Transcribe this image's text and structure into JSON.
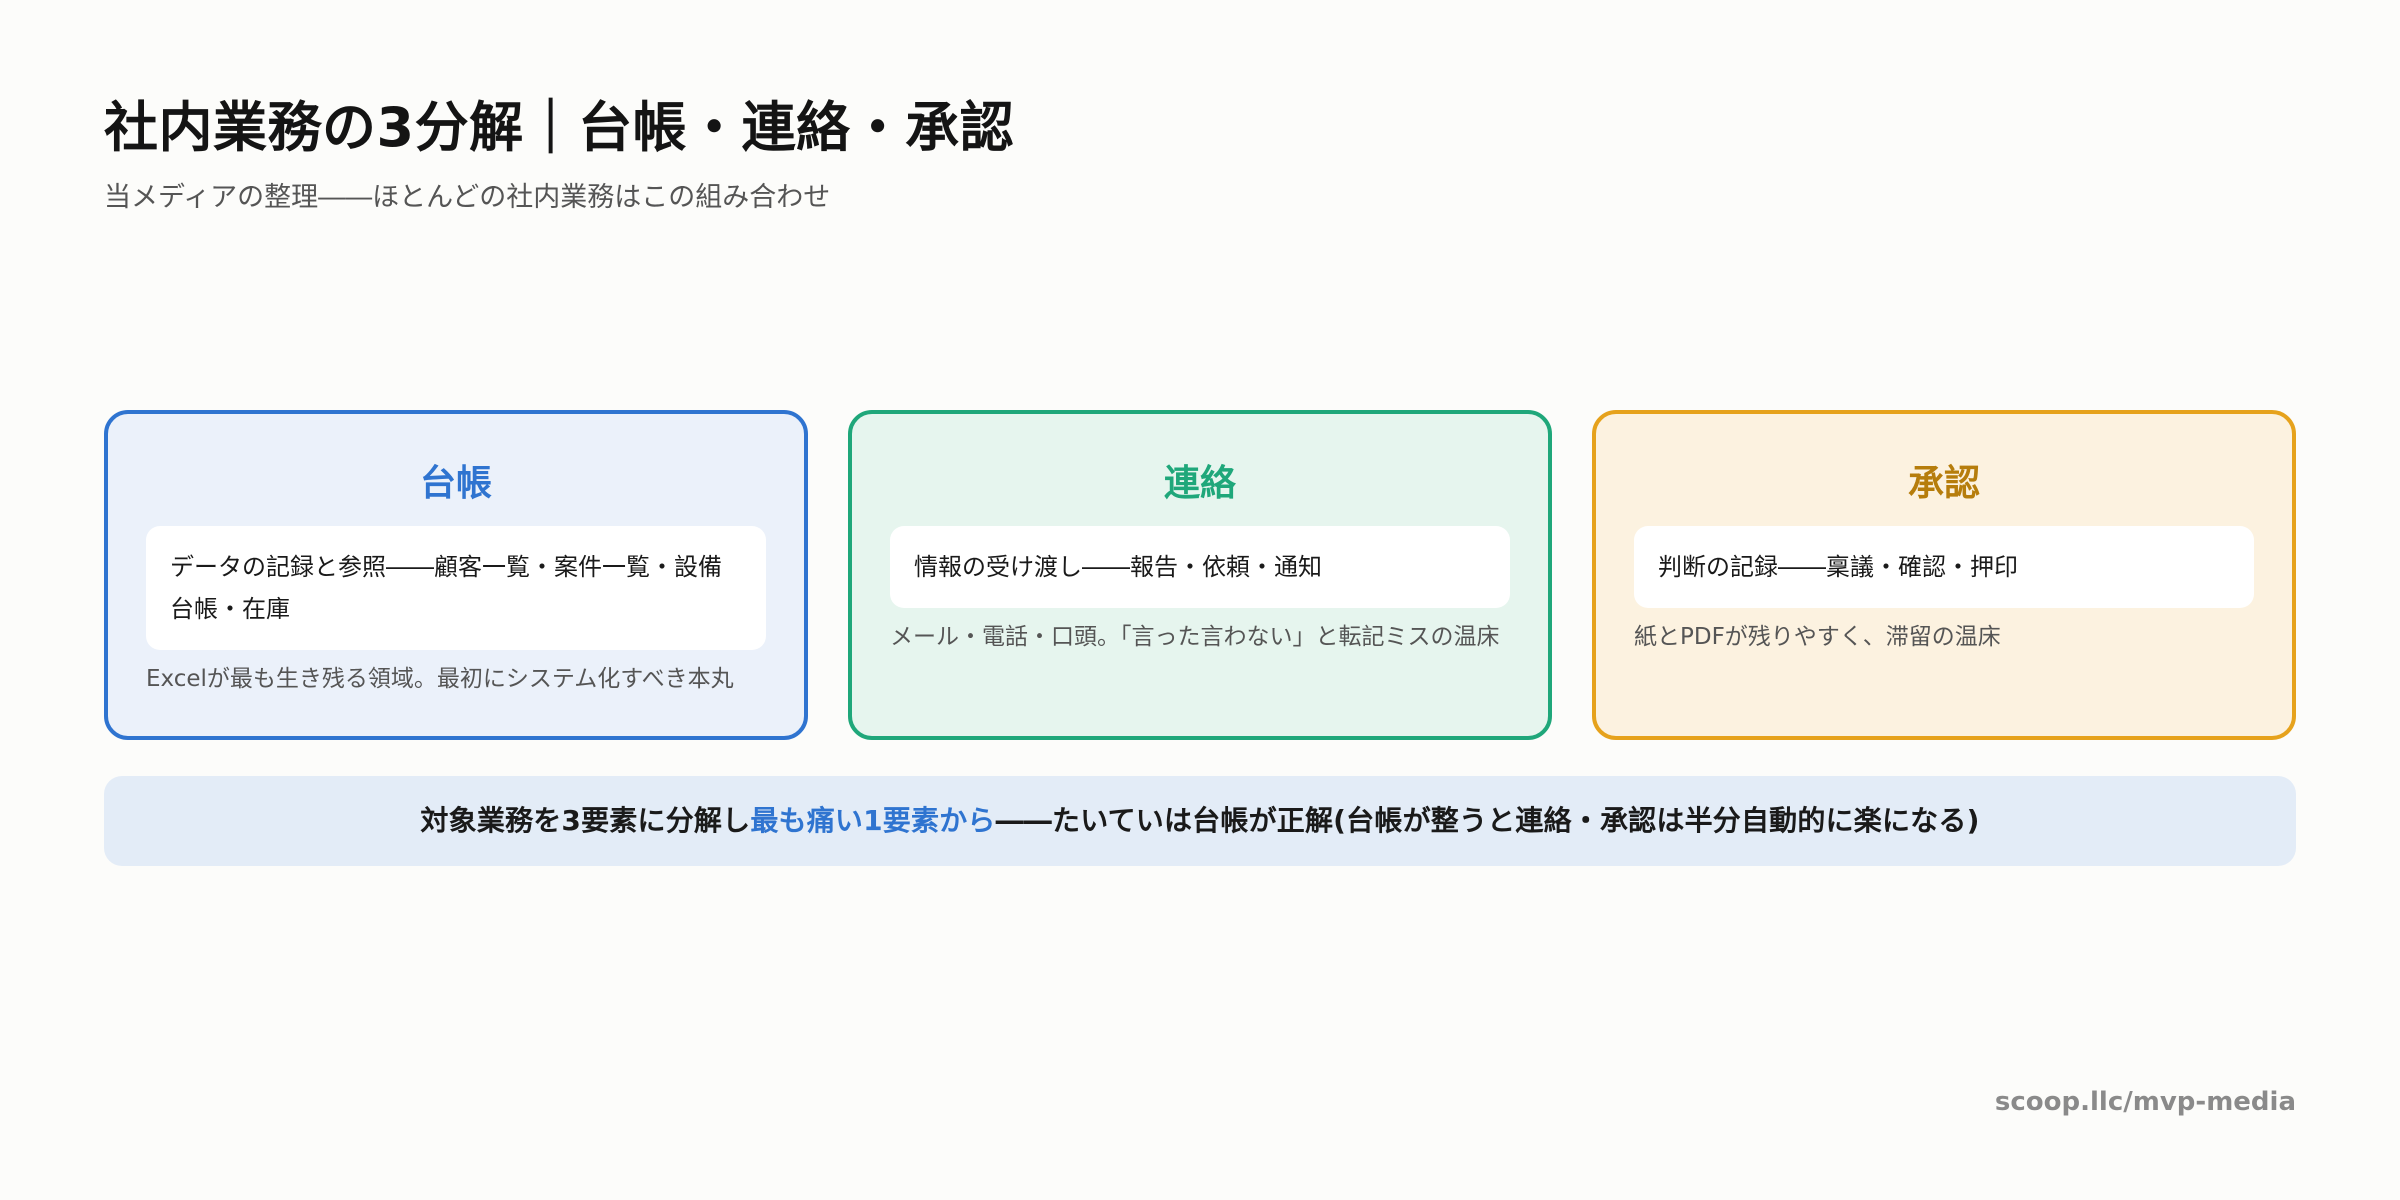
{
  "title": "社内業務の3分解｜台帳・連絡・承認",
  "subtitle": "当メディアの整理――ほとんどの社内業務はこの組み合わせ",
  "cards": [
    {
      "title": "台帳",
      "detail": "データの記録と参照――顧客一覧・案件一覧・設備台帳・在庫",
      "note": "Excelが最も生き残る領域。最初にシステム化すべき本丸",
      "accent": "#2f74d0",
      "background": "#ebf1fa"
    },
    {
      "title": "連絡",
      "detail": "情報の受け渡し――報告・依頼・通知",
      "note": "メール・電話・口頭。「言った言わない」と転記ミスの温床",
      "accent": "#1fa77a",
      "background": "#e6f5ee"
    },
    {
      "title": "承認",
      "detail": "判断の記録――稟議・確認・押印",
      "note": "紙とPDFが残りやすく、滞留の温床",
      "accent": "#e6a21c",
      "title_color": "#b67d0c",
      "background": "#fcf2e0"
    }
  ],
  "banner": {
    "before": "対象業務を3要素に分解し",
    "highlight": "最も痛い1要素から",
    "after": "――たいていは台帳が正解(台帳が整うと連絡・承認は半分自動的に楽になる)",
    "highlight_color": "#2f74d0"
  },
  "footer": "scoop.llc/mvp-media"
}
